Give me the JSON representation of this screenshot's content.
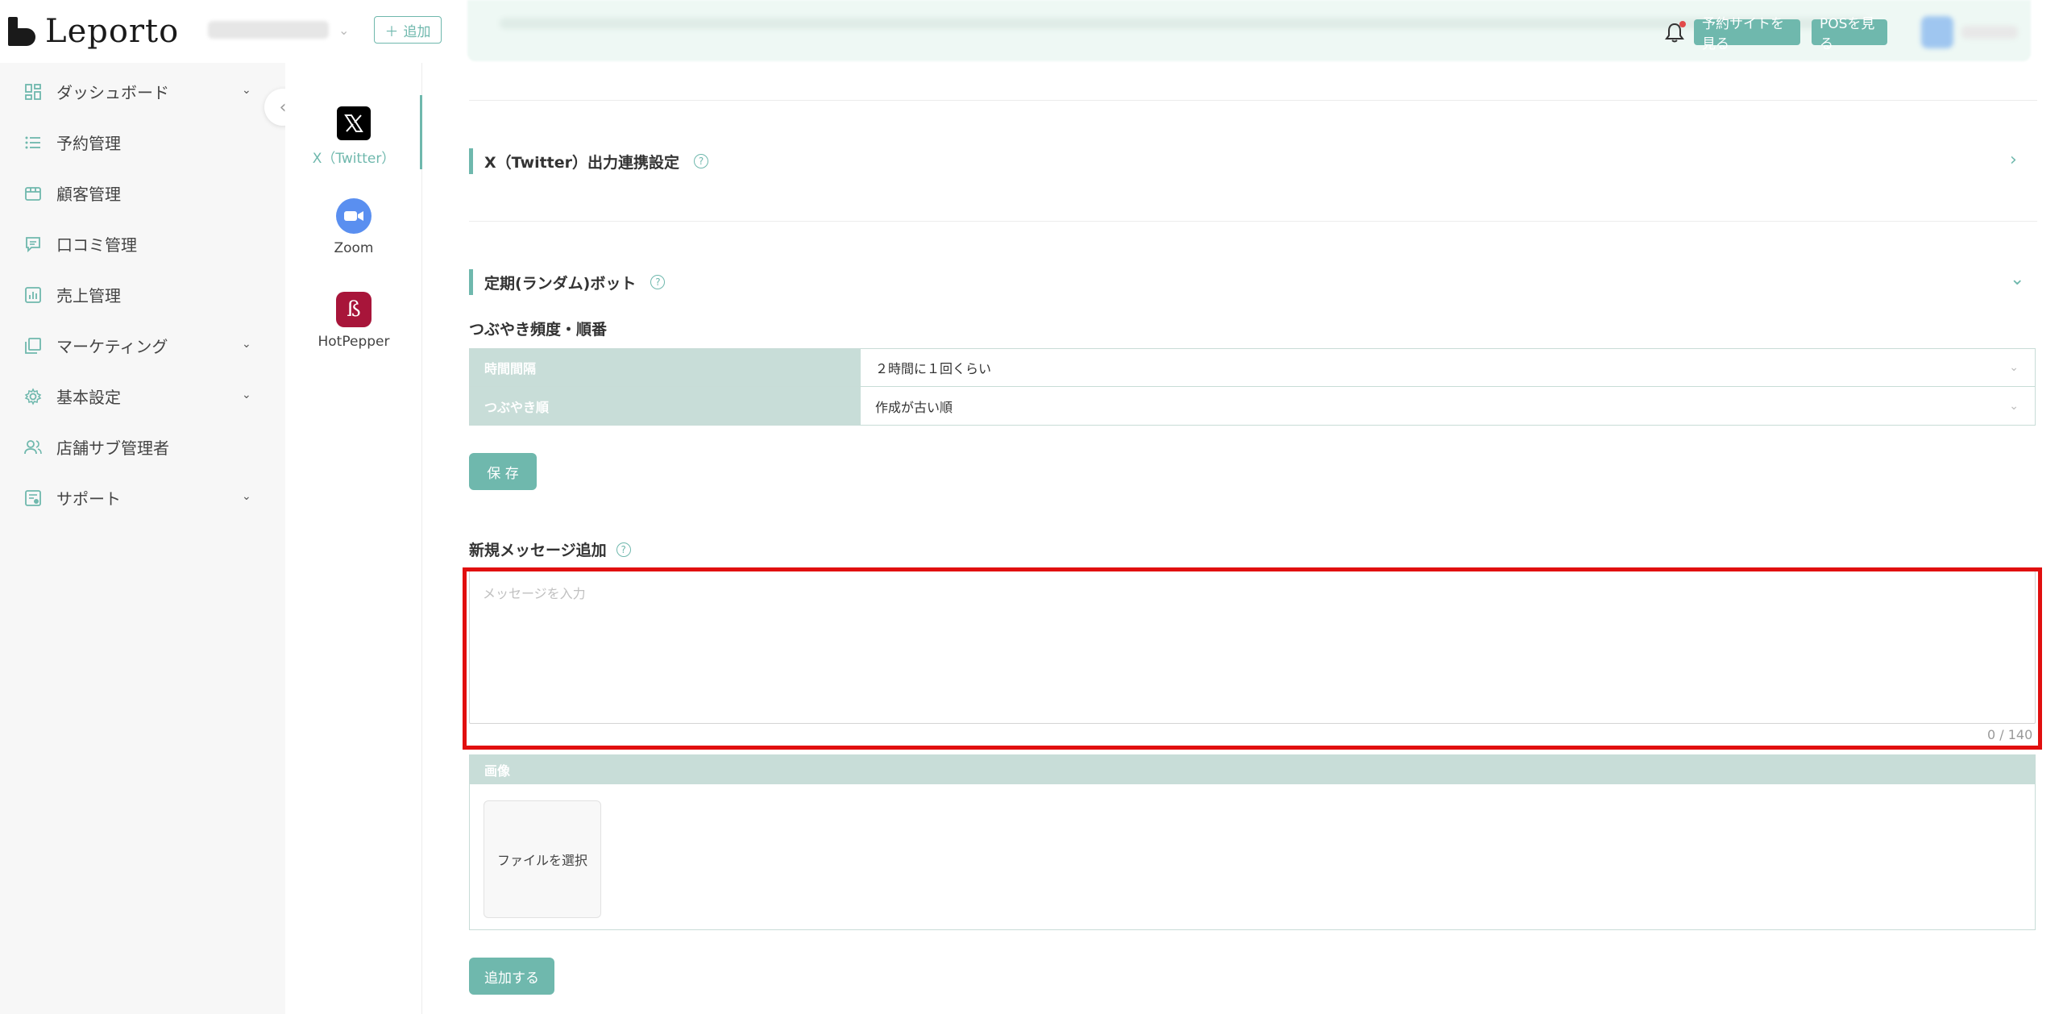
{
  "header": {
    "logo_text": "Leporto",
    "add_store_label": "追加",
    "reserve_site_button": "予約サイトを見る",
    "pos_button": "POSを見る"
  },
  "sidebar": {
    "items": [
      {
        "label": "ダッシュボード",
        "icon": "dashboard-icon",
        "expandable": true
      },
      {
        "label": "予約管理",
        "icon": "list-icon",
        "expandable": false
      },
      {
        "label": "顧客管理",
        "icon": "store-icon",
        "expandable": false
      },
      {
        "label": "口コミ管理",
        "icon": "comment-icon",
        "expandable": false
      },
      {
        "label": "売上管理",
        "icon": "chart-icon",
        "expandable": false
      },
      {
        "label": "マーケティング",
        "icon": "copy-icon",
        "expandable": true
      },
      {
        "label": "基本設定",
        "icon": "gear-icon",
        "expandable": true
      },
      {
        "label": "店舗サブ管理者",
        "icon": "users-icon",
        "expandable": false
      },
      {
        "label": "サポート",
        "icon": "support-icon",
        "expandable": true
      }
    ]
  },
  "integrations": [
    {
      "label": "X（Twitter）",
      "icon": "x-logo-icon",
      "active": true
    },
    {
      "label": "Zoom",
      "icon": "zoom-logo-icon",
      "active": false
    },
    {
      "label": "HotPepper",
      "icon": "hotpepper-logo-icon",
      "active": false
    }
  ],
  "main": {
    "section1_title": "X（Twitter）出力連携設定",
    "section2_title": "定期(ランダム)ボット",
    "frequency_label": "つぶやき頻度・順番",
    "settings": [
      {
        "label": "時間間隔",
        "value": "２時間に１回くらい"
      },
      {
        "label": "つぶやき順",
        "value": "作成が古い順"
      }
    ],
    "save_button": "保 存",
    "new_message_label": "新規メッセージ追加",
    "message_placeholder": "メッセージを入力",
    "counter": "0 / 140",
    "image_label": "画像",
    "file_select_label": "ファイルを選択",
    "add_button": "追加する"
  },
  "colors": {
    "accent": "#6fb8ad",
    "table_header": "#c8ddd8",
    "highlight": "#e10f0f"
  }
}
